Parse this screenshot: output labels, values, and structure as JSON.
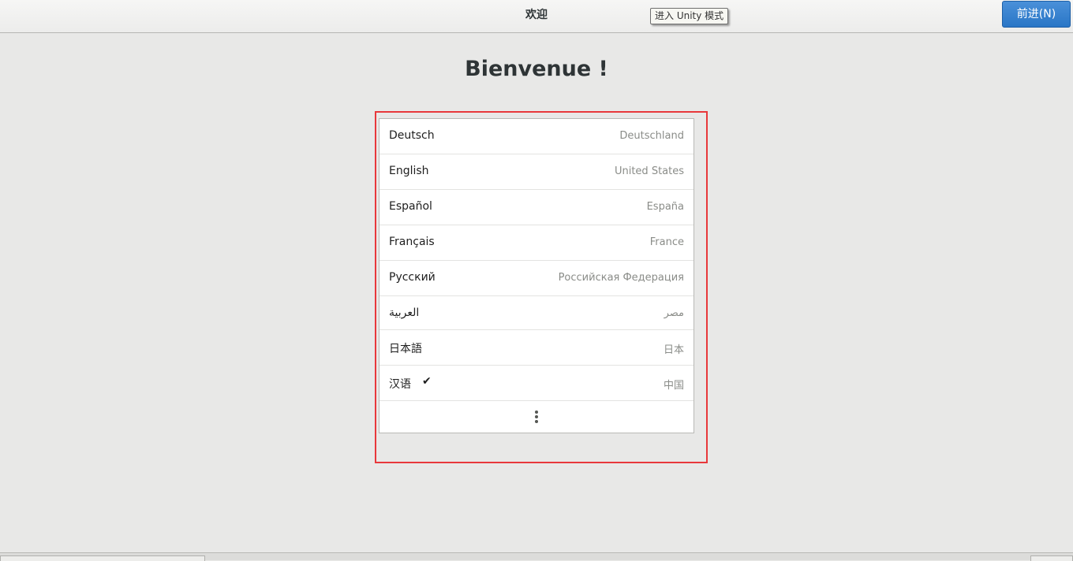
{
  "header": {
    "title": "欢迎",
    "tooltip": "进入 Unity 模式",
    "next_button": "前进(N)"
  },
  "main": {
    "welcome": "Bienvenue !"
  },
  "languages": [
    {
      "name": "Deutsch",
      "region": "Deutschland",
      "selected": false
    },
    {
      "name": "English",
      "region": "United States",
      "selected": false
    },
    {
      "name": "Español",
      "region": "España",
      "selected": false
    },
    {
      "name": "Français",
      "region": "France",
      "selected": false
    },
    {
      "name": "Русский",
      "region": "Российская Федерация",
      "selected": false
    },
    {
      "name": "العربية",
      "region": "مصر",
      "selected": false
    },
    {
      "name": "日本語",
      "region": "日本",
      "selected": false
    },
    {
      "name": "汉语",
      "region": "中国",
      "selected": true
    }
  ],
  "icons": {
    "check": "check-icon",
    "more": "vertical-ellipsis-icon"
  },
  "colors": {
    "accent": "#2a76c6",
    "highlight_frame": "#e8383b"
  }
}
